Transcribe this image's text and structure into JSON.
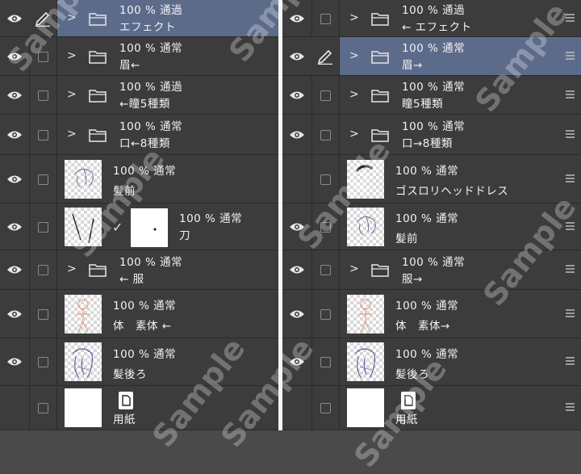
{
  "watermark": "Sample",
  "left_panel": {
    "rows": [
      {
        "type": "folder",
        "visible": true,
        "edit": true,
        "selected": true,
        "line1": "100 % 通過",
        "line2": "エフェクト"
      },
      {
        "type": "folder",
        "visible": true,
        "edit": false,
        "selected": false,
        "line1": "100 % 通常",
        "line2": "眉←"
      },
      {
        "type": "folder",
        "visible": true,
        "edit": false,
        "selected": false,
        "line1": "100 % 通過",
        "line2": "←瞳5種類"
      },
      {
        "type": "folder",
        "visible": true,
        "edit": false,
        "selected": false,
        "line1": "100 % 通常",
        "line2": "口←8種類"
      },
      {
        "type": "layer",
        "visible": true,
        "line1": "100 % 通常",
        "line2": "髪前",
        "thumb": "hair-front"
      },
      {
        "type": "layer-mask",
        "visible": true,
        "line1": "100 % 通常",
        "line2": "刀",
        "thumb": "sword"
      },
      {
        "type": "folder",
        "visible": true,
        "line1": "100 % 通常",
        "line2": "← 服"
      },
      {
        "type": "layer",
        "visible": true,
        "line1": "100 % 通常",
        "line2": "体　素体 ←",
        "thumb": "body"
      },
      {
        "type": "layer",
        "visible": true,
        "line1": "100 % 通常",
        "line2": "髪後ろ",
        "thumb": "hair-back"
      },
      {
        "type": "paper",
        "visible": false,
        "line1": "",
        "line2": "用紙",
        "thumb": "white"
      }
    ]
  },
  "right_panel": {
    "rows": [
      {
        "type": "folder",
        "visible": true,
        "selected": false,
        "line1": "100 % 通過",
        "line2": "← エフェクト"
      },
      {
        "type": "folder",
        "visible": true,
        "edit": true,
        "selected": true,
        "line1": "100 % 通常",
        "line2": "眉→"
      },
      {
        "type": "folder",
        "visible": true,
        "line1": "100 % 通常",
        "line2": "瞳5種類"
      },
      {
        "type": "folder",
        "visible": true,
        "line1": "100 % 通常",
        "line2": "口→8種類"
      },
      {
        "type": "layer",
        "visible": false,
        "line1": "100 % 通常",
        "line2": "ゴスロリヘッドドレス",
        "thumb": "headdress"
      },
      {
        "type": "layer",
        "visible": true,
        "line1": "100 % 通常",
        "line2": "髪前",
        "thumb": "hair-front"
      },
      {
        "type": "folder",
        "visible": true,
        "line1": "100 % 通常",
        "line2": "服→"
      },
      {
        "type": "layer",
        "visible": true,
        "line1": "100 % 通常",
        "line2": "体　素体→",
        "thumb": "body"
      },
      {
        "type": "layer",
        "visible": true,
        "line1": "100 % 通常",
        "line2": "髪後ろ",
        "thumb": "hair-back"
      },
      {
        "type": "paper",
        "visible": false,
        "line1": "",
        "line2": "用紙",
        "thumb": "white"
      }
    ]
  }
}
